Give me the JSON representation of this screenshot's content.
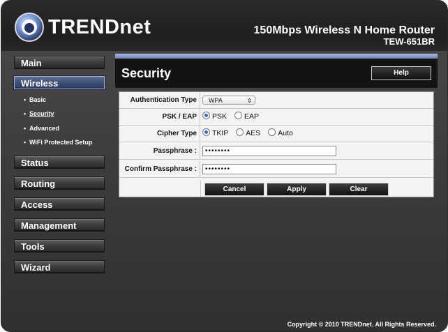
{
  "brand": {
    "logo_text": "TRENDnet"
  },
  "header": {
    "product_title": "150Mbps Wireless N Home Router",
    "model": "TEW-651BR"
  },
  "sidebar": {
    "items": [
      {
        "label": "Main",
        "active": false
      },
      {
        "label": "Wireless",
        "active": true
      },
      {
        "label": "Status",
        "active": false
      },
      {
        "label": "Routing",
        "active": false
      },
      {
        "label": "Access",
        "active": false
      },
      {
        "label": "Management",
        "active": false
      },
      {
        "label": "Tools",
        "active": false
      },
      {
        "label": "Wizard",
        "active": false
      }
    ],
    "wireless_sub": [
      {
        "label": "Basic"
      },
      {
        "label": "Security"
      },
      {
        "label": "Advanced"
      },
      {
        "label": "WiFi Protected Setup"
      }
    ],
    "bullet": "•"
  },
  "panel": {
    "title": "Security",
    "help_label": "Help",
    "fields": {
      "auth_type": {
        "label": "Authentication Type",
        "value": "WPA"
      },
      "psk_eap": {
        "label": "PSK / EAP",
        "options": [
          "PSK",
          "EAP"
        ],
        "selected": "PSK"
      },
      "cipher": {
        "label": "Cipher Type",
        "options": [
          "TKIP",
          "AES",
          "Auto"
        ],
        "selected": "TKIP"
      },
      "passphrase": {
        "label": "Passphrase :",
        "value": "••••••••"
      },
      "confirm": {
        "label": "Confirm Passphrase :",
        "value": "••••••••"
      }
    },
    "buttons": {
      "cancel": "Cancel",
      "apply": "Apply",
      "clear": "Clear"
    }
  },
  "footer": {
    "copyright": "Copyright © 2010 TRENDnet. All Rights Reserved."
  },
  "colors": {
    "accent_blue": "#3c4d75",
    "panel_head": "#131313",
    "background": "#3a3a3a"
  },
  "icons": {
    "logo": "trendnet-eye-logo-icon",
    "select": "dropdown-arrows-icon"
  }
}
